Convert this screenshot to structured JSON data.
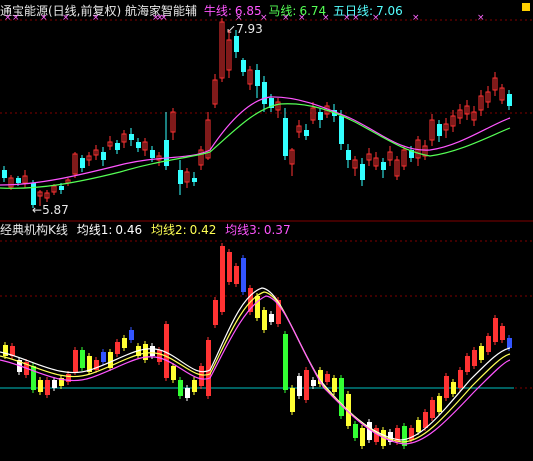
{
  "header": {
    "title": "通宝能源(日线,前复权) 航海家智能辅",
    "ma_lines": [
      {
        "label": "牛线:",
        "value": "6.85",
        "color": "#ff55ff"
      },
      {
        "label": "马线:",
        "value": "6.74",
        "color": "#55ff55"
      },
      {
        "label": "五日线:",
        "value": "7.06",
        "color": "#55ffff"
      }
    ]
  },
  "upper_panel": {
    "high_label": "7.93",
    "low_label": "5.87"
  },
  "lower_panel": {
    "title": "经典机构K线",
    "indicators": [
      {
        "label": "均线1:",
        "value": "0.46",
        "color": "#ffffff"
      },
      {
        "label": "均线2:",
        "value": "0.42",
        "color": "#ffff55"
      },
      {
        "label": "均线3:",
        "value": "0.37",
        "color": "#ff55ff"
      }
    ]
  },
  "colors": {
    "up": "#ff3333",
    "down": "#33ffff",
    "grid": "#800000",
    "zero_line": "#00c0c0",
    "ma_pink": "#ff55ff",
    "ma_green": "#55ff55"
  }
}
